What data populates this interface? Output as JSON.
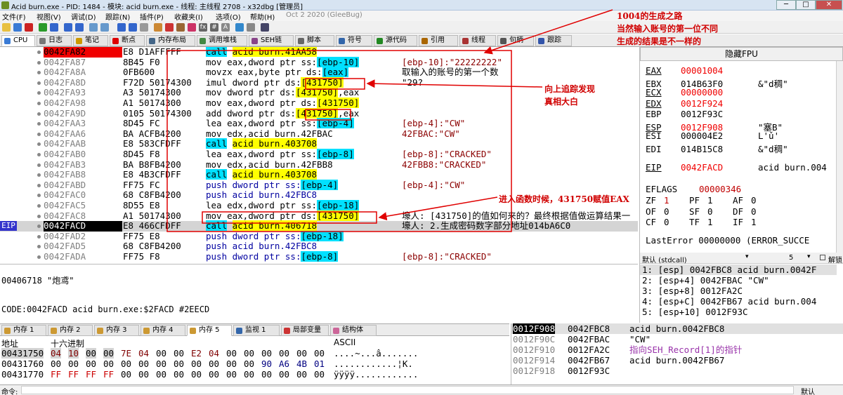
{
  "window": {
    "title": "Acid burn.exe - PID: 1484 - 模块: acid burn.exe - 线程: 主线程 2708 - x32dbg [管理员]"
  },
  "menu": {
    "items": [
      "文件(F)",
      "视图(V)",
      "调试(D)",
      "跟踪(N)",
      "插件(P)",
      "收藏夹(I)",
      "选项(O)",
      "帮助(H)"
    ],
    "date": "Oct 2 2020 (GleeBug)"
  },
  "tabs": [
    {
      "label": "CPU",
      "icon": "cpu-icon",
      "color": "#3a7bd5"
    },
    {
      "label": "日志",
      "icon": "log-icon",
      "color": "#777777"
    },
    {
      "label": "笔记",
      "icon": "notes-icon",
      "color": "#cc9900"
    },
    {
      "label": "断点",
      "icon": "breakpoint-icon",
      "color": "#dd0000"
    },
    {
      "label": "内存布局",
      "icon": "memory-map-icon",
      "color": "#446688"
    },
    {
      "label": "调用堆栈",
      "icon": "call-stack-icon",
      "color": "#448844"
    },
    {
      "label": "SEH链",
      "icon": "seh-icon",
      "color": "#884488"
    },
    {
      "label": "脚本",
      "icon": "script-icon",
      "color": "#666666"
    },
    {
      "label": "符号",
      "icon": "symbols-icon",
      "color": "#3366aa"
    },
    {
      "label": "源代码",
      "icon": "source-icon",
      "color": "#228822"
    },
    {
      "label": "引用",
      "icon": "references-icon",
      "color": "#aa6600"
    },
    {
      "label": "线程",
      "icon": "threads-icon",
      "color": "#aa3333"
    },
    {
      "label": "句柄",
      "icon": "handles-icon",
      "color": "#555555"
    },
    {
      "label": "跟踪",
      "icon": "trace-icon",
      "color": "#3355aa"
    }
  ],
  "disasm": [
    {
      "addr": "0042FA82",
      "bytes": "E8 D1AFFFFF",
      "mn": "call",
      "op": "acid burn.41AA58",
      "kind": "call",
      "cmt": "",
      "bp": true
    },
    {
      "addr": "0042FA87",
      "bytes": "8B45 F0",
      "mn": "mov",
      "pre": "eax,dword ptr ss:",
      "hl": "[ebp-10]",
      "hlc": "cyan",
      "kind": "mem",
      "cmt": "[ebp-10]:\"22222222\"",
      "cmtc": "str"
    },
    {
      "addr": "0042FA8A",
      "bytes": "0FB600",
      "mn": "movzx",
      "pre": "eax,byte ptr ds:",
      "hl": "[eax]",
      "hlc": "cyan",
      "kind": "mem",
      "cmt": "取输入的账号的第一个数",
      "cmtc": "plain"
    },
    {
      "addr": "0042FA8D",
      "bytes": "F72D 50174300",
      "mn": "imul",
      "pre": "dword ptr ds:",
      "hl": "[431750]",
      "hlc": "yellow",
      "kind": "mem",
      "cmt": "\"29?",
      "cmtc": "plain"
    },
    {
      "addr": "0042FA93",
      "bytes": "A3 50174300",
      "mn": "mov",
      "pre": "dword ptr ds:",
      "hl": "[431750]",
      "hlc": "yellow",
      "post": ",eax",
      "kind": "mem",
      "cmt": ""
    },
    {
      "addr": "0042FA98",
      "bytes": "A1 50174300",
      "mn": "mov",
      "pre": "eax,dword ptr ds:",
      "hl": "[431750]",
      "hlc": "yellow",
      "kind": "mem",
      "cmt": ""
    },
    {
      "addr": "0042FA9D",
      "bytes": "0105 50174300",
      "mn": "add",
      "pre": "dword ptr ds:",
      "hl": "[431750]",
      "hlc": "yellow",
      "post": ",eax",
      "kind": "mem",
      "cmt": ""
    },
    {
      "addr": "0042FAA3",
      "bytes": "8D45 FC",
      "mn": "lea",
      "pre": "eax,dword ptr ss:",
      "hl": "[ebp-4]",
      "hlc": "cyan",
      "kind": "mem",
      "cmt": "[ebp-4]:\"CW\"",
      "cmtc": "str"
    },
    {
      "addr": "0042FAA6",
      "bytes": "BA ACFB4200",
      "mn": "mov",
      "pre": "edx,acid burn.42FBAC",
      "kind": "plain",
      "cmt": "42FBAC:\"CW\"",
      "cmtc": "str"
    },
    {
      "addr": "0042FAAB",
      "bytes": "E8 583CFDFF",
      "mn": "call",
      "op": "acid burn.403708",
      "kind": "call",
      "cmt": ""
    },
    {
      "addr": "0042FAB0",
      "bytes": "8D45 F8",
      "mn": "lea",
      "pre": "eax,dword ptr ss:",
      "hl": "[ebp-8]",
      "hlc": "cyan",
      "kind": "mem",
      "cmt": "[ebp-8]:\"CRACKED\"",
      "cmtc": "str"
    },
    {
      "addr": "0042FAB3",
      "bytes": "BA B8FB4200",
      "mn": "mov",
      "pre": "edx,acid burn.42FBB8",
      "kind": "plain",
      "cmt": "42FBB8:\"CRACKED\"",
      "cmtc": "str"
    },
    {
      "addr": "0042FAB8",
      "bytes": "E8 4B3CFDFF",
      "mn": "call",
      "op": "acid burn.403708",
      "kind": "call",
      "cmt": ""
    },
    {
      "addr": "0042FABD",
      "bytes": "FF75 FC",
      "mn": "push",
      "pre": "dword ptr ss:",
      "hl": "[ebp-4]",
      "hlc": "cyan",
      "kind": "push",
      "cmt": "[ebp-4]:\"CW\"",
      "cmtc": "str"
    },
    {
      "addr": "0042FAC0",
      "bytes": "68 C8FB4200",
      "mn": "push",
      "pre": "acid burn.42FBC8",
      "kind": "push",
      "cmt": ""
    },
    {
      "addr": "0042FAC5",
      "bytes": "8D55 E8",
      "mn": "lea",
      "pre": "edx,dword ptr ss:",
      "hl": "[ebp-18]",
      "hlc": "cyan",
      "kind": "mem",
      "cmt": ""
    },
    {
      "addr": "0042FAC8",
      "bytes": "A1 50174300",
      "mn": "mov",
      "pre": "eax,dword ptr ds:",
      "hl": "[431750]",
      "hlc": "yellow",
      "kind": "mem",
      "cmt": "壕人: [431750]的值如何来的？最终根据值做运算结果一",
      "cmtc": "plain"
    },
    {
      "addr": "0042FACD",
      "bytes": "E8 466CFDFF",
      "mn": "call",
      "op": "acid burn.406718",
      "kind": "call",
      "cmt": "壕人: 2.生成密码数字部分地址014bA6C0",
      "cmtc": "plain",
      "eip": true
    },
    {
      "addr": "0042FAD2",
      "bytes": "FF75 E8",
      "mn": "push",
      "pre": "dword ptr ss:",
      "hl": "[ebp-18]",
      "hlc": "cyan",
      "kind": "push",
      "cmt": ""
    },
    {
      "addr": "0042FAD5",
      "bytes": "68 C8FB4200",
      "mn": "push",
      "pre": "acid burn.42FBC8",
      "kind": "push",
      "cmt": ""
    },
    {
      "addr": "0042FADA",
      "bytes": "FF75 F8",
      "mn": "push",
      "pre": "dword ptr ss:",
      "hl": "[ebp-8]",
      "hlc": "cyan",
      "kind": "push",
      "cmt": "[ebp-8]:\"CRACKED\"",
      "cmtc": "str"
    }
  ],
  "eip_label": "EIP",
  "regs": {
    "header": "隐藏FPU",
    "rows": [
      {
        "n": "EAX",
        "v": "00001004",
        "x": "",
        "chg": true
      },
      {
        "n": "EBX",
        "v": "014B63F0",
        "x": "&\"d稠\"",
        "chg": false
      },
      {
        "n": "ECX",
        "v": "00000000",
        "x": "",
        "chg": true
      },
      {
        "n": "EDX",
        "v": "0012F924",
        "x": "",
        "chg": true
      },
      {
        "n": "EBP",
        "v": "0012F93C",
        "x": "",
        "chg": false
      },
      {
        "n": "ESP",
        "v": "0012F908",
        "x": "\"塞B\"",
        "chg": true
      },
      {
        "n": "ESI",
        "v": "000004E2",
        "x": "L'ǔ'",
        "chg": false
      },
      {
        "n": "EDI",
        "v": "014B15C8",
        "x": "&\"d稠\"",
        "chg": false
      }
    ],
    "eip": {
      "n": "EIP",
      "v": "0042FACD",
      "x": "acid burn.004"
    },
    "eflags": {
      "n": "EFLAGS",
      "v": "00000346"
    },
    "flags": [
      [
        "ZF",
        "1",
        "PF",
        "1",
        "AF",
        "0"
      ],
      [
        "OF",
        "0",
        "SF",
        "0",
        "DF",
        "0"
      ],
      [
        "CF",
        "0",
        "TF",
        "1",
        "IF",
        "1"
      ]
    ],
    "lasterror": "LastError  00000000 (ERROR_SUCCE"
  },
  "callstack": {
    "conv": "默认 (stdcall)",
    "count": "5",
    "unlock_label": "解锁",
    "rows": [
      "1: [esp] 0042FBC8 acid burn.0042F",
      "2: [esp+4] 0042FBAC \"CW\"",
      "3: [esp+8] 0012FA2C",
      "4: [esp+C] 0042FB67 acid burn.004",
      "5: [esp+10] 0012F93C"
    ]
  },
  "info": {
    "line1": "00406718 \"炮鸢\"",
    "line2": "CODE:0042FACD acid burn.exe:$2FACD #2EECD"
  },
  "memtabs": [
    "内存 1",
    "内存 2",
    "内存 3",
    "内存 4",
    "内存 5",
    "监视 1",
    "局部变量",
    "结构体"
  ],
  "dump": {
    "col_addr": "地址",
    "col_hex": "十六进制",
    "col_ascii": "ASCII",
    "rows": [
      {
        "a": "00431750",
        "h": [
          "04",
          "10",
          "00",
          "00",
          "7E",
          "04",
          "00",
          "00",
          "E2",
          "04",
          "00",
          "00",
          "00",
          "00",
          "00",
          "00"
        ],
        "s": "....~...â......."
      },
      {
        "a": "00431760",
        "h": [
          "00",
          "00",
          "00",
          "00",
          "00",
          "00",
          "00",
          "00",
          "00",
          "00",
          "00",
          "00",
          "90",
          "A6",
          "4B",
          "01"
        ],
        "s": "............¦K."
      },
      {
        "a": "00431770",
        "h": [
          "FF",
          "FF",
          "FF",
          "FF",
          "00",
          "00",
          "00",
          "00",
          "00",
          "00",
          "00",
          "00",
          "00",
          "00",
          "00",
          "00"
        ],
        "s": "ÿÿÿÿ............"
      }
    ]
  },
  "stack": [
    {
      "a": "0012F908",
      "v": "0042FBC8",
      "c": "acid burn.0042FBC8",
      "cur": true
    },
    {
      "a": "0012F90C",
      "v": "0042FBAC",
      "c": "\"CW\"",
      "cur": false
    },
    {
      "a": "0012F910",
      "v": "0012FA2C",
      "c": "指向SEH_Record[1]的指针",
      "cur": false,
      "purple": true
    },
    {
      "a": "0012F914",
      "v": "0042FB67",
      "c": "acid burn.0042FB67",
      "cur": false
    },
    {
      "a": "0012F918",
      "v": "0012F93C",
      "c": "",
      "cur": false
    }
  ],
  "cmdbar": {
    "label": "命令:",
    "right": "默认"
  },
  "annotations": {
    "a1": "1004的生成之路",
    "a2": "当然输入账号的第一位不同",
    "a3": "生成的结果是不一样的",
    "a4": "向上追踪发现",
    "a5": "真相大白",
    "a6": "进入函数时候，431750赋值EAX"
  }
}
